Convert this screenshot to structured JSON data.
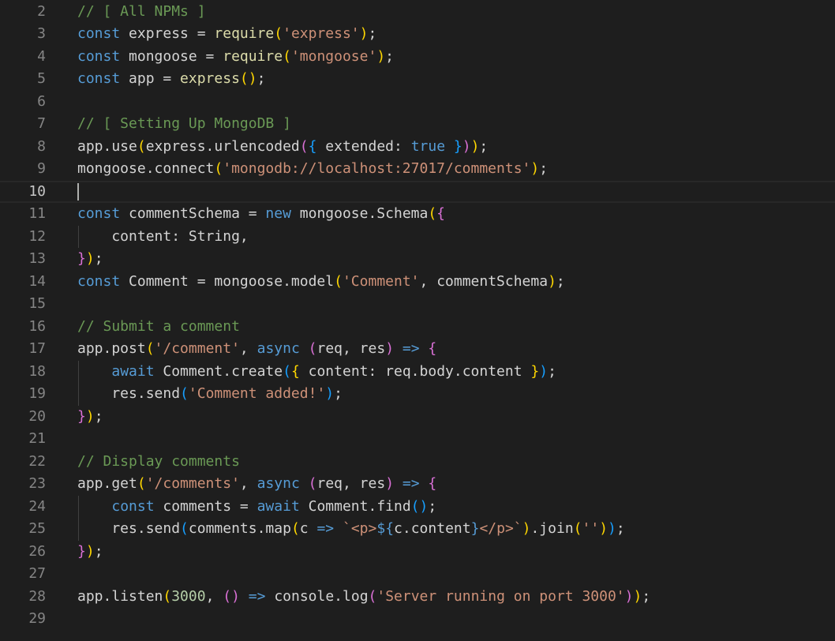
{
  "editor": {
    "language": "javascript",
    "current_line": 10,
    "lines": [
      {
        "n": "2",
        "tokens": [
          [
            "cmt",
            "// [ All NPMs ]"
          ]
        ]
      },
      {
        "n": "3",
        "tokens": [
          [
            "kw",
            "const"
          ],
          [
            "id",
            " express = "
          ],
          [
            "fn",
            "require"
          ],
          [
            "b1",
            "("
          ],
          [
            "str",
            "'express'"
          ],
          [
            "b1",
            ")"
          ],
          [
            "id",
            ";"
          ]
        ]
      },
      {
        "n": "4",
        "tokens": [
          [
            "kw",
            "const"
          ],
          [
            "id",
            " mongoose = "
          ],
          [
            "fn",
            "require"
          ],
          [
            "b1",
            "("
          ],
          [
            "str",
            "'mongoose'"
          ],
          [
            "b1",
            ")"
          ],
          [
            "id",
            ";"
          ]
        ]
      },
      {
        "n": "5",
        "tokens": [
          [
            "kw",
            "const"
          ],
          [
            "id",
            " app = "
          ],
          [
            "fn",
            "express"
          ],
          [
            "b1",
            "()"
          ],
          [
            "id",
            ";"
          ]
        ]
      },
      {
        "n": "6",
        "tokens": []
      },
      {
        "n": "7",
        "tokens": [
          [
            "cmt",
            "// [ Setting Up MongoDB ]"
          ]
        ]
      },
      {
        "n": "8",
        "tokens": [
          [
            "id",
            "app.use"
          ],
          [
            "b1",
            "("
          ],
          [
            "id",
            "express.urlencoded"
          ],
          [
            "b2",
            "("
          ],
          [
            "b3",
            "{"
          ],
          [
            "id",
            " extended: "
          ],
          [
            "kw",
            "true"
          ],
          [
            "b3",
            " }"
          ],
          [
            "b2",
            ")"
          ],
          [
            "b1",
            ")"
          ],
          [
            "id",
            ";"
          ]
        ]
      },
      {
        "n": "9",
        "tokens": [
          [
            "id",
            "mongoose.connect"
          ],
          [
            "b1",
            "("
          ],
          [
            "str",
            "'mongodb://localhost:27017/comments'"
          ],
          [
            "b1",
            ")"
          ],
          [
            "id",
            ";"
          ]
        ]
      },
      {
        "n": "10",
        "tokens": []
      },
      {
        "n": "11",
        "tokens": [
          [
            "kw",
            "const"
          ],
          [
            "id",
            " commentSchema = "
          ],
          [
            "kw",
            "new"
          ],
          [
            "id",
            " mongoose.Schema"
          ],
          [
            "b1",
            "("
          ],
          [
            "b2",
            "{"
          ]
        ]
      },
      {
        "n": "12",
        "tokens": [
          [
            "id",
            "    content: String,"
          ]
        ]
      },
      {
        "n": "13",
        "tokens": [
          [
            "b2",
            "}"
          ],
          [
            "b1",
            ")"
          ],
          [
            "id",
            ";"
          ]
        ]
      },
      {
        "n": "14",
        "tokens": [
          [
            "kw",
            "const"
          ],
          [
            "id",
            " Comment = mongoose.model"
          ],
          [
            "b1",
            "("
          ],
          [
            "str",
            "'Comment'"
          ],
          [
            "id",
            ", commentSchema"
          ],
          [
            "b1",
            ")"
          ],
          [
            "id",
            ";"
          ]
        ]
      },
      {
        "n": "15",
        "tokens": []
      },
      {
        "n": "16",
        "tokens": [
          [
            "cmt",
            "// Submit a comment"
          ]
        ]
      },
      {
        "n": "17",
        "tokens": [
          [
            "id",
            "app.post"
          ],
          [
            "b1",
            "("
          ],
          [
            "str",
            "'/comment'"
          ],
          [
            "id",
            ", "
          ],
          [
            "kw",
            "async"
          ],
          [
            "id",
            " "
          ],
          [
            "b2",
            "("
          ],
          [
            "id",
            "req, res"
          ],
          [
            "b2",
            ")"
          ],
          [
            "id",
            " "
          ],
          [
            "kw",
            "=>"
          ],
          [
            "id",
            " "
          ],
          [
            "b2",
            "{"
          ]
        ]
      },
      {
        "n": "18",
        "tokens": [
          [
            "id",
            "    "
          ],
          [
            "kw",
            "await"
          ],
          [
            "id",
            " Comment.create"
          ],
          [
            "b3",
            "("
          ],
          [
            "b1",
            "{"
          ],
          [
            "id",
            " content: req.body.content "
          ],
          [
            "b1",
            "}"
          ],
          [
            "b3",
            ")"
          ],
          [
            "id",
            ";"
          ]
        ]
      },
      {
        "n": "19",
        "tokens": [
          [
            "id",
            "    res.send"
          ],
          [
            "b3",
            "("
          ],
          [
            "str",
            "'Comment added!'"
          ],
          [
            "b3",
            ")"
          ],
          [
            "id",
            ";"
          ]
        ]
      },
      {
        "n": "20",
        "tokens": [
          [
            "b2",
            "}"
          ],
          [
            "b1",
            ")"
          ],
          [
            "id",
            ";"
          ]
        ]
      },
      {
        "n": "21",
        "tokens": []
      },
      {
        "n": "22",
        "tokens": [
          [
            "cmt",
            "// Display comments"
          ]
        ]
      },
      {
        "n": "23",
        "tokens": [
          [
            "id",
            "app.get"
          ],
          [
            "b1",
            "("
          ],
          [
            "str",
            "'/comments'"
          ],
          [
            "id",
            ", "
          ],
          [
            "kw",
            "async"
          ],
          [
            "id",
            " "
          ],
          [
            "b2",
            "("
          ],
          [
            "id",
            "req, res"
          ],
          [
            "b2",
            ")"
          ],
          [
            "id",
            " "
          ],
          [
            "kw",
            "=>"
          ],
          [
            "id",
            " "
          ],
          [
            "b2",
            "{"
          ]
        ]
      },
      {
        "n": "24",
        "tokens": [
          [
            "id",
            "    "
          ],
          [
            "kw",
            "const"
          ],
          [
            "id",
            " comments = "
          ],
          [
            "kw",
            "await"
          ],
          [
            "id",
            " Comment.find"
          ],
          [
            "b3",
            "()"
          ],
          [
            "id",
            ";"
          ]
        ]
      },
      {
        "n": "25",
        "tokens": [
          [
            "id",
            "    res.send"
          ],
          [
            "b3",
            "("
          ],
          [
            "id",
            "comments.map"
          ],
          [
            "b1",
            "("
          ],
          [
            "id",
            "c "
          ],
          [
            "kw",
            "=>"
          ],
          [
            "id",
            " "
          ],
          [
            "str",
            "`<p>"
          ],
          [
            "kw",
            "${"
          ],
          [
            "id",
            "c.content"
          ],
          [
            "kw",
            "}"
          ],
          [
            "str",
            "</p>`"
          ],
          [
            "b1",
            ")"
          ],
          [
            "id",
            ".join"
          ],
          [
            "b1",
            "("
          ],
          [
            "str",
            "''"
          ],
          [
            "b1",
            ")"
          ],
          [
            "b3",
            ")"
          ],
          [
            "id",
            ";"
          ]
        ]
      },
      {
        "n": "26",
        "tokens": [
          [
            "b2",
            "}"
          ],
          [
            "b1",
            ")"
          ],
          [
            "id",
            ";"
          ]
        ]
      },
      {
        "n": "27",
        "tokens": []
      },
      {
        "n": "28",
        "tokens": [
          [
            "id",
            "app.listen"
          ],
          [
            "b1",
            "("
          ],
          [
            "num",
            "3000"
          ],
          [
            "id",
            ", "
          ],
          [
            "b2",
            "()"
          ],
          [
            "id",
            " "
          ],
          [
            "kw",
            "=>"
          ],
          [
            "id",
            " console.log"
          ],
          [
            "b2",
            "("
          ],
          [
            "str",
            "'Server running on port 3000'"
          ],
          [
            "b2",
            ")"
          ],
          [
            "b1",
            ")"
          ],
          [
            "id",
            ";"
          ]
        ]
      },
      {
        "n": "29",
        "tokens": []
      }
    ]
  },
  "theme": {
    "background": "#1e1e1e",
    "keyword": "#569cd6",
    "string": "#ce9178",
    "comment": "#6a9955",
    "number": "#b5cea8",
    "bracket_1": "#ffd700",
    "bracket_2": "#da70d6",
    "bracket_3": "#179fff"
  }
}
